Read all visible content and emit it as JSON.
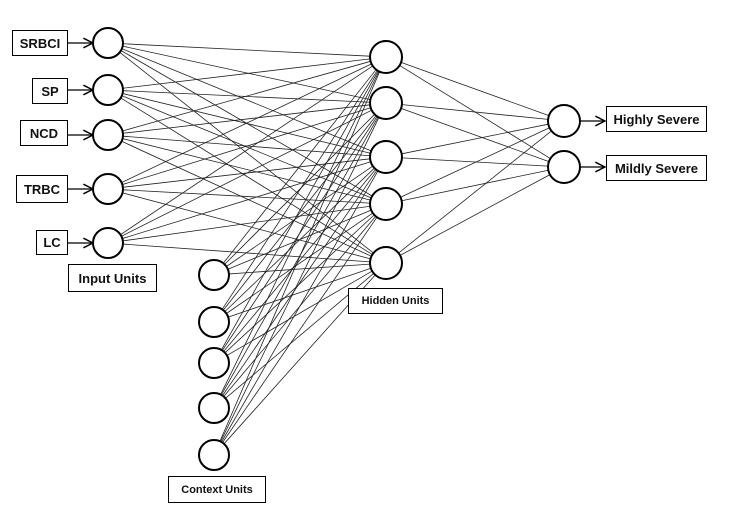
{
  "inputs": [
    "SRBCI",
    "SP",
    "NCD",
    "TRBC",
    "LC"
  ],
  "outputs": [
    "Highly Severe",
    "Mildly Severe"
  ],
  "labels": {
    "input_units": "Input Units",
    "hidden_units": "Hidden Units",
    "context_units": "Context Units"
  },
  "hidden_count": 5,
  "context_count": 5,
  "connections": "fully connected: input→hidden, context→hidden, hidden→output"
}
